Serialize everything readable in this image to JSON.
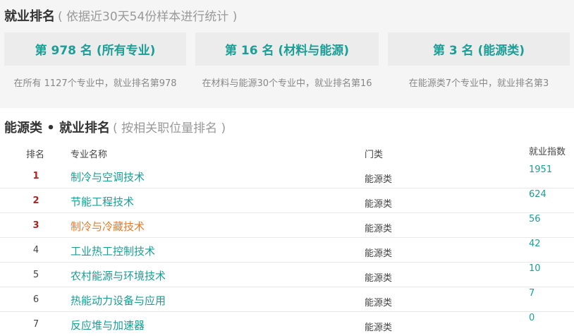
{
  "summary": {
    "title": "就业排名",
    "subtitle": "( 依据近30天54份样本进行统计 )",
    "cards": [
      {
        "label": "第 978 名 (所有专业)",
        "desc": "在所有 1127个专业中，就业排名第978"
      },
      {
        "label": "第 16 名 (材料与能源)",
        "desc": "在材料与能源30个专业中，就业排名第16"
      },
      {
        "label": "第 3 名 (能源类)",
        "desc": "在能源类7个专业中，就业排名第3"
      }
    ]
  },
  "category_ranking": {
    "title": "能源类 • 就业排名",
    "subtitle": "( 按相关职位量排名 )",
    "columns": {
      "rank": "排名",
      "name": "专业名称",
      "category": "门类",
      "index": "就业指数"
    },
    "rows": [
      {
        "rank": "1",
        "name": "制冷与空调技术",
        "category": "能源类",
        "index": "1951"
      },
      {
        "rank": "2",
        "name": "节能工程技术",
        "category": "能源类",
        "index": "624"
      },
      {
        "rank": "3",
        "name": "制冷与冷藏技术",
        "category": "能源类",
        "index": "56"
      },
      {
        "rank": "4",
        "name": "工业热工控制技术",
        "category": "能源类",
        "index": "42"
      },
      {
        "rank": "5",
        "name": "农村能源与环境技术",
        "category": "能源类",
        "index": "10"
      },
      {
        "rank": "6",
        "name": "热能动力设备与应用",
        "category": "能源类",
        "index": "7"
      },
      {
        "rank": "7",
        "name": "反应堆与加速器",
        "category": "能源类",
        "index": "0"
      }
    ]
  },
  "colors": {
    "accent": "#1a9e95",
    "highlight": "#e87a29",
    "top_rank": "#b22222"
  }
}
